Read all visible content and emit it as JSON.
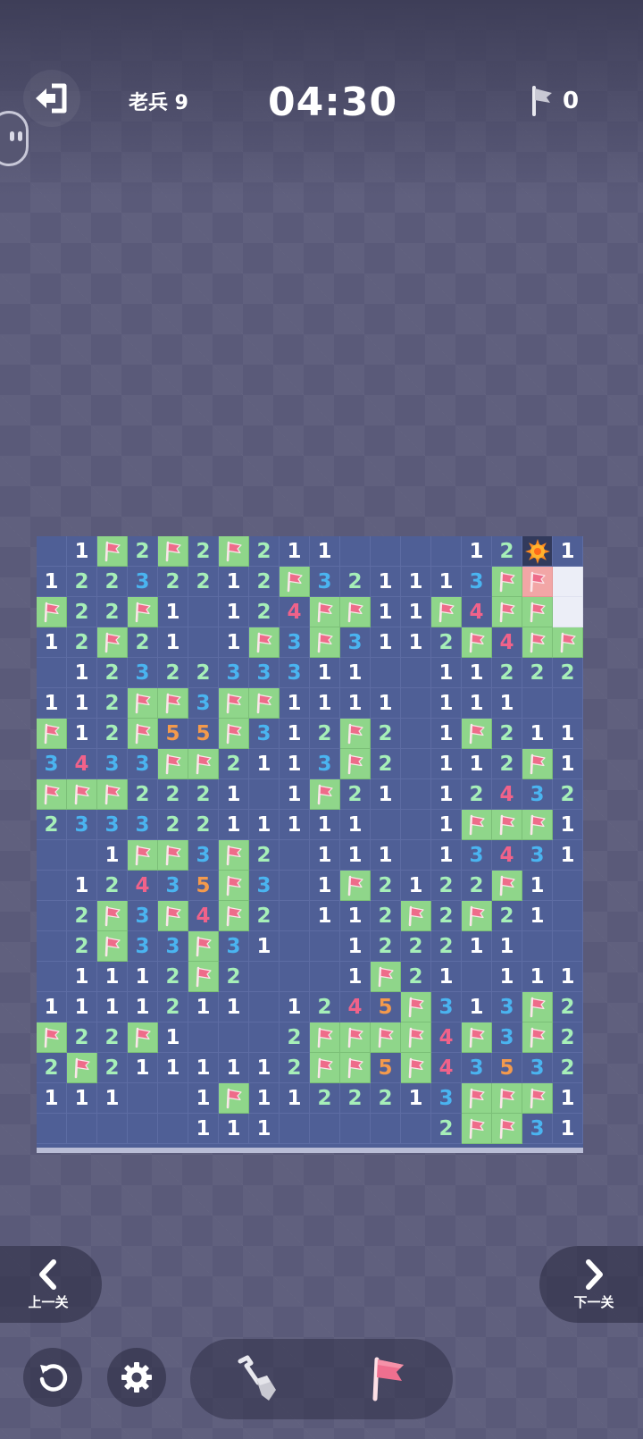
{
  "header": {
    "level_label": "老兵 9",
    "timer": "04:30",
    "flag_count": "0"
  },
  "icons": {
    "exit": "exit-icon",
    "flag": "flag-icon",
    "mine": "mine-icon",
    "shovel": "shovel-icon",
    "undo": "undo-icon",
    "settings": "gear-icon"
  },
  "colors": {
    "board_background": "#4f5f96",
    "flag_cell": "#8fd68a",
    "revealed_empty_cell": "#eceef7",
    "wrong_flag_cell": "#f2a6a6",
    "mine_cell": "#323a5c",
    "number_1": "#ffffff",
    "number_2": "#a6efb8",
    "number_3": "#4ab4f0",
    "number_4": "#f0628a",
    "number_5": "#f49a4c"
  },
  "board": {
    "rows": [
      "_1F2F2F2111____12M1",
      "122322121F3211113FRC",
      "F22F1_12FFF11F4FF_",
      "12F21_1F3F311_2F4FF",
      "_12322333F11__11222",
      "112FF3FF1111__111__",
      "F12F55F312F2__1F211",
      "3433FF2113F2__112F1",
      "FFF2221_1F21__1243 2",
      "2333221111 1__1FFF1",
      "__1FF3F2_111__1343 1",
      "_12435F3_1F212 2F1_",
      "_2F3F4F2_112F2F21_",
      "_2F33F31__1222 11__",
      "_1112F2___1F21__111",
      "111121 1_1245F313F2",
      "F22F1___2FFFF4F3F2",
      "2F211111 12FF5F4353 2",
      "111__1F1122213FFF1",
      "_____111______2FF31"
    ],
    "grid": [
      [
        "",
        "1",
        "F",
        "2",
        "F",
        "2",
        "F",
        "2",
        "1",
        "1",
        "",
        "",
        "",
        "",
        "1",
        "2",
        "M",
        "1"
      ],
      [
        "1",
        "2",
        "2",
        "3",
        "2",
        "2",
        "1",
        "2",
        "F",
        "3",
        "2",
        "1",
        "1",
        "1",
        "3",
        "F",
        "R",
        "C"
      ],
      [
        "F",
        "2",
        "2",
        "F",
        "1",
        "",
        "1",
        "2",
        "4",
        "F",
        "F",
        "1",
        "1",
        "F",
        "4",
        "F",
        "F",
        "C"
      ],
      [
        "1",
        "2",
        "F",
        "2",
        "1",
        "",
        "1",
        "F",
        "3",
        "F",
        "3",
        "1",
        "1",
        "2",
        "F",
        "4",
        "F",
        "F"
      ],
      [
        "",
        "1",
        "2",
        "3",
        "2",
        "2",
        "3",
        "3",
        "3",
        "1",
        "1",
        "",
        "",
        "1",
        "1",
        "2",
        "2",
        "2"
      ],
      [
        "1",
        "1",
        "2",
        "F",
        "F",
        "3",
        "F",
        "F",
        "1",
        "1",
        "1",
        "1",
        "",
        "1",
        "1",
        "1",
        "",
        ""
      ],
      [
        "F",
        "1",
        "2",
        "F",
        "5",
        "5",
        "F",
        "3",
        "1",
        "2",
        "F",
        "2",
        "",
        "1",
        "F",
        "2",
        "1",
        "1"
      ],
      [
        "3",
        "4",
        "3",
        "3",
        "F",
        "F",
        "2",
        "1",
        "1",
        "3",
        "F",
        "2",
        "",
        "1",
        "1",
        "2",
        "F",
        "1"
      ],
      [
        "F",
        "F",
        "F",
        "2",
        "2",
        "2",
        "1",
        "",
        "1",
        "F",
        "2",
        "1",
        "",
        "1",
        "2",
        "4",
        "3",
        "2"
      ],
      [
        "2",
        "3",
        "3",
        "3",
        "2",
        "2",
        "1",
        "1",
        "1",
        "1",
        "1",
        "",
        "",
        "1",
        "F",
        "F",
        "F",
        "1"
      ],
      [
        "",
        "",
        "1",
        "F",
        "F",
        "3",
        "F",
        "2",
        "",
        "1",
        "1",
        "1",
        "",
        "1",
        "3",
        "4",
        "3",
        "1"
      ],
      [
        "",
        "1",
        "2",
        "4",
        "3",
        "5",
        "F",
        "3",
        "",
        "1",
        "F",
        "2",
        "1",
        "2",
        "2",
        "F",
        "1",
        ""
      ],
      [
        "",
        "2",
        "F",
        "3",
        "F",
        "4",
        "F",
        "2",
        "",
        "1",
        "1",
        "2",
        "F",
        "2",
        "F",
        "2",
        "1",
        ""
      ],
      [
        "",
        "2",
        "F",
        "3",
        "3",
        "F",
        "3",
        "1",
        "",
        "",
        "1",
        "2",
        "2",
        "2",
        "1",
        "1",
        "",
        ""
      ],
      [
        "",
        "1",
        "1",
        "1",
        "2",
        "F",
        "2",
        "",
        "",
        "",
        "1",
        "F",
        "2",
        "1",
        "",
        "1",
        "1",
        "1"
      ],
      [
        "1",
        "1",
        "1",
        "1",
        "2",
        "1",
        "1",
        "",
        "1",
        "2",
        "4",
        "5",
        "F",
        "3",
        "1",
        "3",
        "F",
        "2"
      ],
      [
        "F",
        "2",
        "2",
        "F",
        "1",
        "",
        "",
        "",
        "2",
        "F",
        "F",
        "F",
        "F",
        "4",
        "F",
        "3",
        "F",
        "2"
      ],
      [
        "2",
        "F",
        "2",
        "1",
        "1",
        "1",
        "1",
        "1",
        "2",
        "F",
        "F",
        "5",
        "F",
        "4",
        "3",
        "5",
        "3",
        "2"
      ],
      [
        "1",
        "1",
        "1",
        "",
        "",
        "1",
        "F",
        "1",
        "1",
        "2",
        "2",
        "2",
        "1",
        "3",
        "F",
        "F",
        "F",
        "1"
      ],
      [
        "",
        "",
        "",
        "",
        "",
        "1",
        "1",
        "1",
        "",
        "",
        "",
        "",
        "",
        "2",
        "F",
        "F",
        "3",
        "1"
      ]
    ],
    "legend": {
      "F": "flag",
      "M": "exploded-mine",
      "R": "wrong-flag",
      "C": "unrevealed"
    }
  },
  "nav": {
    "prev_label": "上一关",
    "next_label": "下一关"
  }
}
